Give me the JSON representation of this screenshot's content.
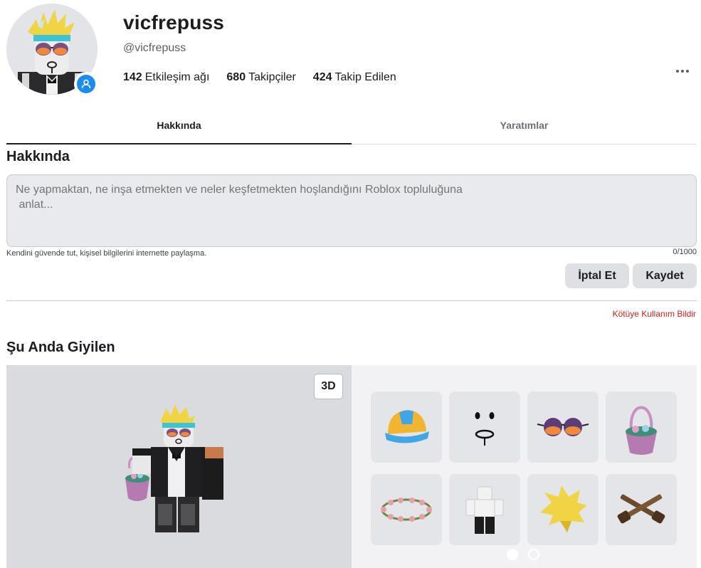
{
  "profile": {
    "display_name": "vicfrepuss",
    "username": "@vicfrepuss",
    "avatar_icon": "avatar-headshot",
    "online_badge_icon": "online-status-icon",
    "online_color": "#1a8cf0"
  },
  "stats": [
    {
      "count": "142",
      "label": "Etkileşim ağı"
    },
    {
      "count": "680",
      "label": "Takipçiler"
    },
    {
      "count": "424",
      "label": "Takip Edilen"
    }
  ],
  "tabs": [
    {
      "label": "Hakkında",
      "active": true
    },
    {
      "label": "Yaratımlar",
      "active": false
    }
  ],
  "about": {
    "title": "Hakkında",
    "placeholder": "Ne yapmaktan, ne inşa etmekten ve neler keşfetmekten hoşlandığını Roblox topluluğuna\n anlat...",
    "safety_note": "Kendini güvende tut, kişisel bilgilerini internette paylaşma.",
    "char_count": "0/1000",
    "cancel_label": "İptal Et",
    "save_label": "Kaydet",
    "report_label": "Kötüye Kullanım Bildir",
    "report_color": "#d0201c"
  },
  "wearing": {
    "title": "Şu Anda Giyilen",
    "view_toggle_label": "3D",
    "items": [
      {
        "icon": "hard-hat-icon"
      },
      {
        "icon": "face-icon"
      },
      {
        "icon": "sunglasses-icon"
      },
      {
        "icon": "easter-basket-icon"
      },
      {
        "icon": "flower-crown-icon"
      },
      {
        "icon": "shirt-pants-icon"
      },
      {
        "icon": "spiky-hair-icon"
      },
      {
        "icon": "crossed-pistols-icon"
      }
    ],
    "page_count": 2,
    "current_page": 1
  }
}
